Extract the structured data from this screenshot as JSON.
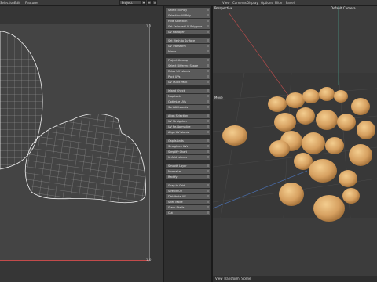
{
  "menubar": {
    "items": [
      "Selection",
      "Edit",
      "Features"
    ],
    "project_dropdown": "Project",
    "viewport_menu": [
      "View",
      "Cameras",
      "Display",
      "Options",
      "Filter",
      "Panel"
    ]
  },
  "uv_editor": {
    "corner_top_right": "1,1",
    "corner_bottom_right": "1,0"
  },
  "tool_panel": {
    "rows": [
      "Select Fill Poly",
      "Selection All Poly",
      "Hide Selection",
      "Set Selected UV Polygons",
      "UV Manager",
      "Set Mesh to Surface",
      "UV Transform",
      "Mirror",
      "Project Unwrap",
      "Select Different Shape",
      "Relax UV Islands",
      "Pack UVs",
      "UV Quick Pack",
      "Island Check",
      "Map Lock",
      "Optimize UVs",
      "Sort All Islands",
      "Align Selection",
      "UV Straighten",
      "UV Re-Normalize",
      "Align UV Islands",
      "Gap Islands",
      "Straighten UVs",
      "Simplify Chart",
      "Unfold Islands",
      "Smooth Layer",
      "Normalize",
      "Rectify",
      "Snap to Grid",
      "Stretch UV",
      "Distribute UV",
      "Shell Mode",
      "Stack Shells",
      "Cut"
    ]
  },
  "viewport": {
    "title": "Perspective",
    "camera": "Default Camera",
    "tool_label": "Move",
    "status": "View Transform: Scene"
  },
  "colors": {
    "accent": "#c34b4b",
    "beans": "#d9a866",
    "grid": "#555555"
  }
}
